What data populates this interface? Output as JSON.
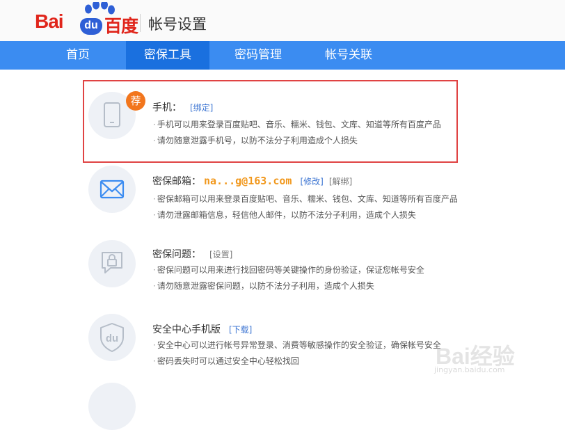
{
  "header": {
    "logo_bai": "Bai",
    "logo_du": "du",
    "logo_cn": "百度",
    "page_title": "帐号设置"
  },
  "nav": {
    "items": [
      {
        "label": "首页",
        "active": false
      },
      {
        "label": "密保工具",
        "active": true
      },
      {
        "label": "密码管理",
        "active": false
      },
      {
        "label": "帐号关联",
        "active": false
      }
    ]
  },
  "items": [
    {
      "icon": "phone-icon",
      "badge": "荐",
      "title": "手机：",
      "links": [
        "[绑定]"
      ],
      "desc": [
        "手机可以用来登录百度贴吧、音乐、糯米、钱包、文库、知道等所有百度产品",
        "请勿随意泄露手机号，以防不法分子利用造成个人损失"
      ]
    },
    {
      "icon": "mail-icon",
      "title": "密保邮箱：",
      "value": "na...g@163.com",
      "links": [
        "[修改]",
        "[解绑]"
      ],
      "desc": [
        "密保邮箱可以用来登录百度贴吧、音乐、糯米、钱包、文库、知道等所有百度产品",
        "请勿泄露邮箱信息，轻信他人邮件，以防不法分子利用，造成个人损失"
      ]
    },
    {
      "icon": "lock-question-icon",
      "title": "密保问题：",
      "links": [
        "[设置]"
      ],
      "desc": [
        "密保问题可以用来进行找回密码等关键操作的身份验证，保证您帐号安全",
        "请勿随意泄露密保问题，以防不法分子利用，造成个人损失"
      ]
    },
    {
      "icon": "shield-du-icon",
      "title": "安全中心手机版",
      "links": [
        "[下载]"
      ],
      "desc": [
        "安全中心可以进行帐号异常登录、消费等敏感操作的安全验证，确保帐号安全",
        "密码丢失时可以通过安全中心轻松找回"
      ]
    }
  ],
  "watermark": {
    "text": "Bai经验",
    "sub": "jingyan.baidu.com"
  },
  "colors": {
    "brand_red": "#e0251b",
    "nav_blue": "#3b8cf1",
    "nav_active": "#1a70df",
    "badge_orange": "#f2761d",
    "email_orange": "#f1981d",
    "link_blue": "#3b74d2",
    "highlight_red": "#e04343"
  }
}
